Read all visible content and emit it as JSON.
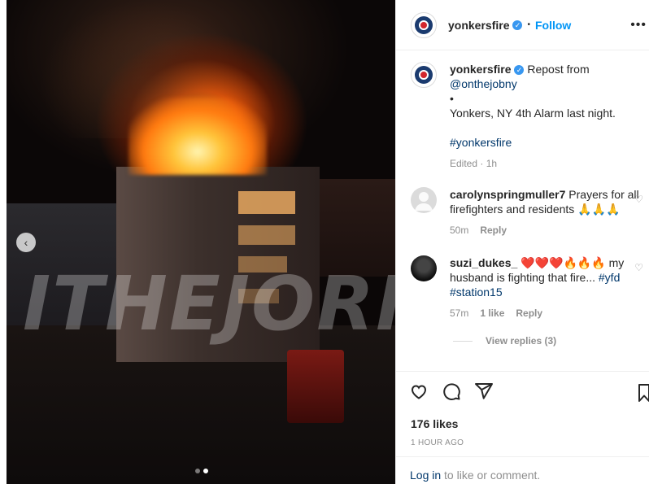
{
  "post": {
    "watermark": "ITHEJORNY",
    "carousel": {
      "total_slides": 2,
      "current_slide": 2
    }
  },
  "header": {
    "username": "yonkersfire",
    "separator": "•",
    "follow_label": "Follow",
    "more_label": "•••"
  },
  "caption": {
    "username": "yonkersfire",
    "lines": [
      "Repost from",
      "@onthejobny",
      "•",
      "Yonkers, NY 4th Alarm last night."
    ],
    "hashtag": "#yonkersfire",
    "edited": "Edited",
    "time": "1h"
  },
  "comments": [
    {
      "username": "carolynspringmuller7",
      "text": "Prayers for all firefighters and residents 🙏🙏🙏",
      "time": "50m",
      "reply_label": "Reply"
    },
    {
      "username": "suzi_dukes_",
      "text": "❤️❤️❤️🔥🔥🔥 my husband is fighting that fire...",
      "tags": [
        "#yfd",
        "#station15"
      ],
      "time": "57m",
      "likes": "1 like",
      "reply_label": "Reply",
      "view_replies": "View replies (3)"
    }
  ],
  "footer": {
    "likes": "176 likes",
    "ago": "1 HOUR AGO",
    "login_link": "Log in",
    "login_rest": " to like or comment."
  },
  "colors": {
    "accent": "#0095f6",
    "link": "#00376b",
    "muted": "#8e8e8e",
    "verified": "#3897f0"
  }
}
